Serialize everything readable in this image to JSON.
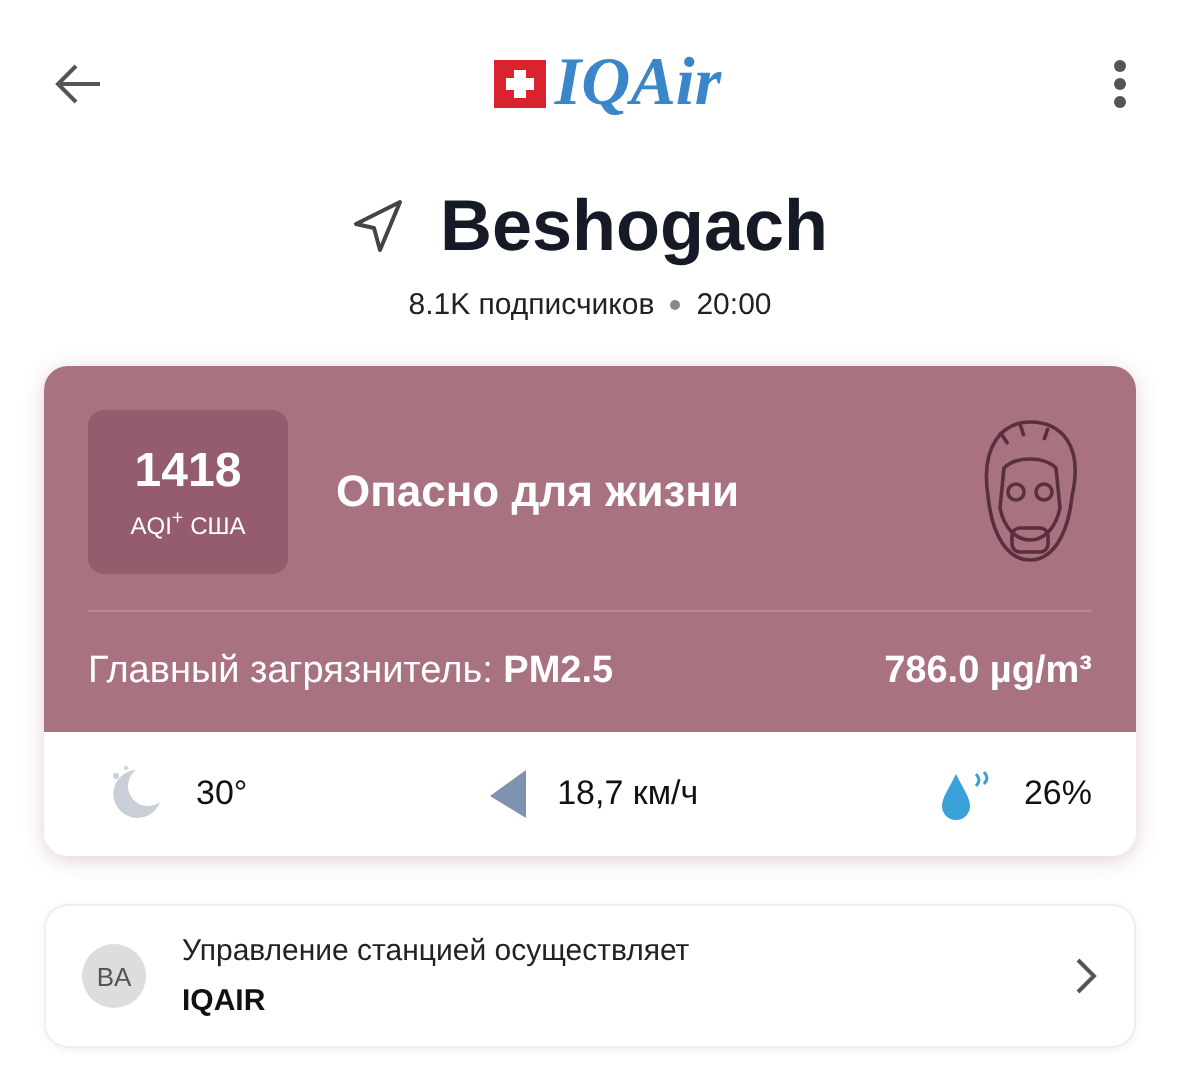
{
  "header": {
    "logo_text": "IQAir"
  },
  "location": {
    "name": "Beshogach",
    "followers": "8.1K подписчиков",
    "time": "20:00"
  },
  "aqi_card": {
    "value": "1418",
    "unit": "AQI$^{+}$ США",
    "status": "Опасно для жизни",
    "pollutant_label": "Главный загрязнитель:",
    "pollutant": "PM2.5",
    "concentration": "786.0 µg/m³"
  },
  "weather": [
    {
      "kind": "night",
      "value": "30°"
    },
    {
      "kind": "wind",
      "value": "18,7 км/ч"
    },
    {
      "kind": "humidity",
      "value": "26%"
    }
  ],
  "station": {
    "avatar": "BA",
    "label": "Управление станцией осуществляет",
    "operator": "IQAIR"
  }
}
